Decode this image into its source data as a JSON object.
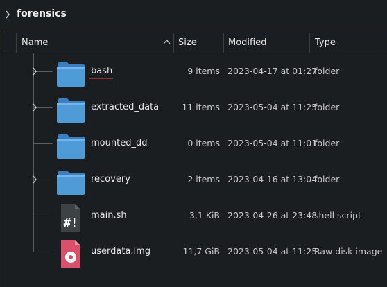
{
  "breadcrumb": {
    "title": "forensics"
  },
  "columns": {
    "name": "Name",
    "size": "Size",
    "modified": "Modified",
    "type": "Type"
  },
  "files": [
    {
      "name": "bash",
      "size": "9 items",
      "modified": "2023-04-17 at 01:27",
      "type": "folder",
      "icon": "folder-icon"
    },
    {
      "name": "extracted_data",
      "size": "11 items",
      "modified": "2023-05-04 at 11:25",
      "type": "folder",
      "icon": "folder-icon"
    },
    {
      "name": "mounted_dd",
      "size": "0 items",
      "modified": "2023-05-04 at 11:01",
      "type": "folder",
      "icon": "folder-icon"
    },
    {
      "name": "recovery",
      "size": "2 items",
      "modified": "2023-04-16 at 13:04",
      "type": "folder",
      "icon": "folder-icon"
    },
    {
      "name": "main.sh",
      "size": "3,1 KiB",
      "modified": "2023-04-26 at 23:48",
      "type": "shell script",
      "icon": "shell-script-icon"
    },
    {
      "name": "userdata.img",
      "size": "11,7 GiB",
      "modified": "2023-05-04 at 11:25",
      "type": "Raw disk image",
      "icon": "disk-image-icon"
    }
  ],
  "colors": {
    "accent_border": "#c9272c",
    "folder": "#4f9bd8",
    "script": "#3d4245",
    "disk": "#d9506a"
  }
}
